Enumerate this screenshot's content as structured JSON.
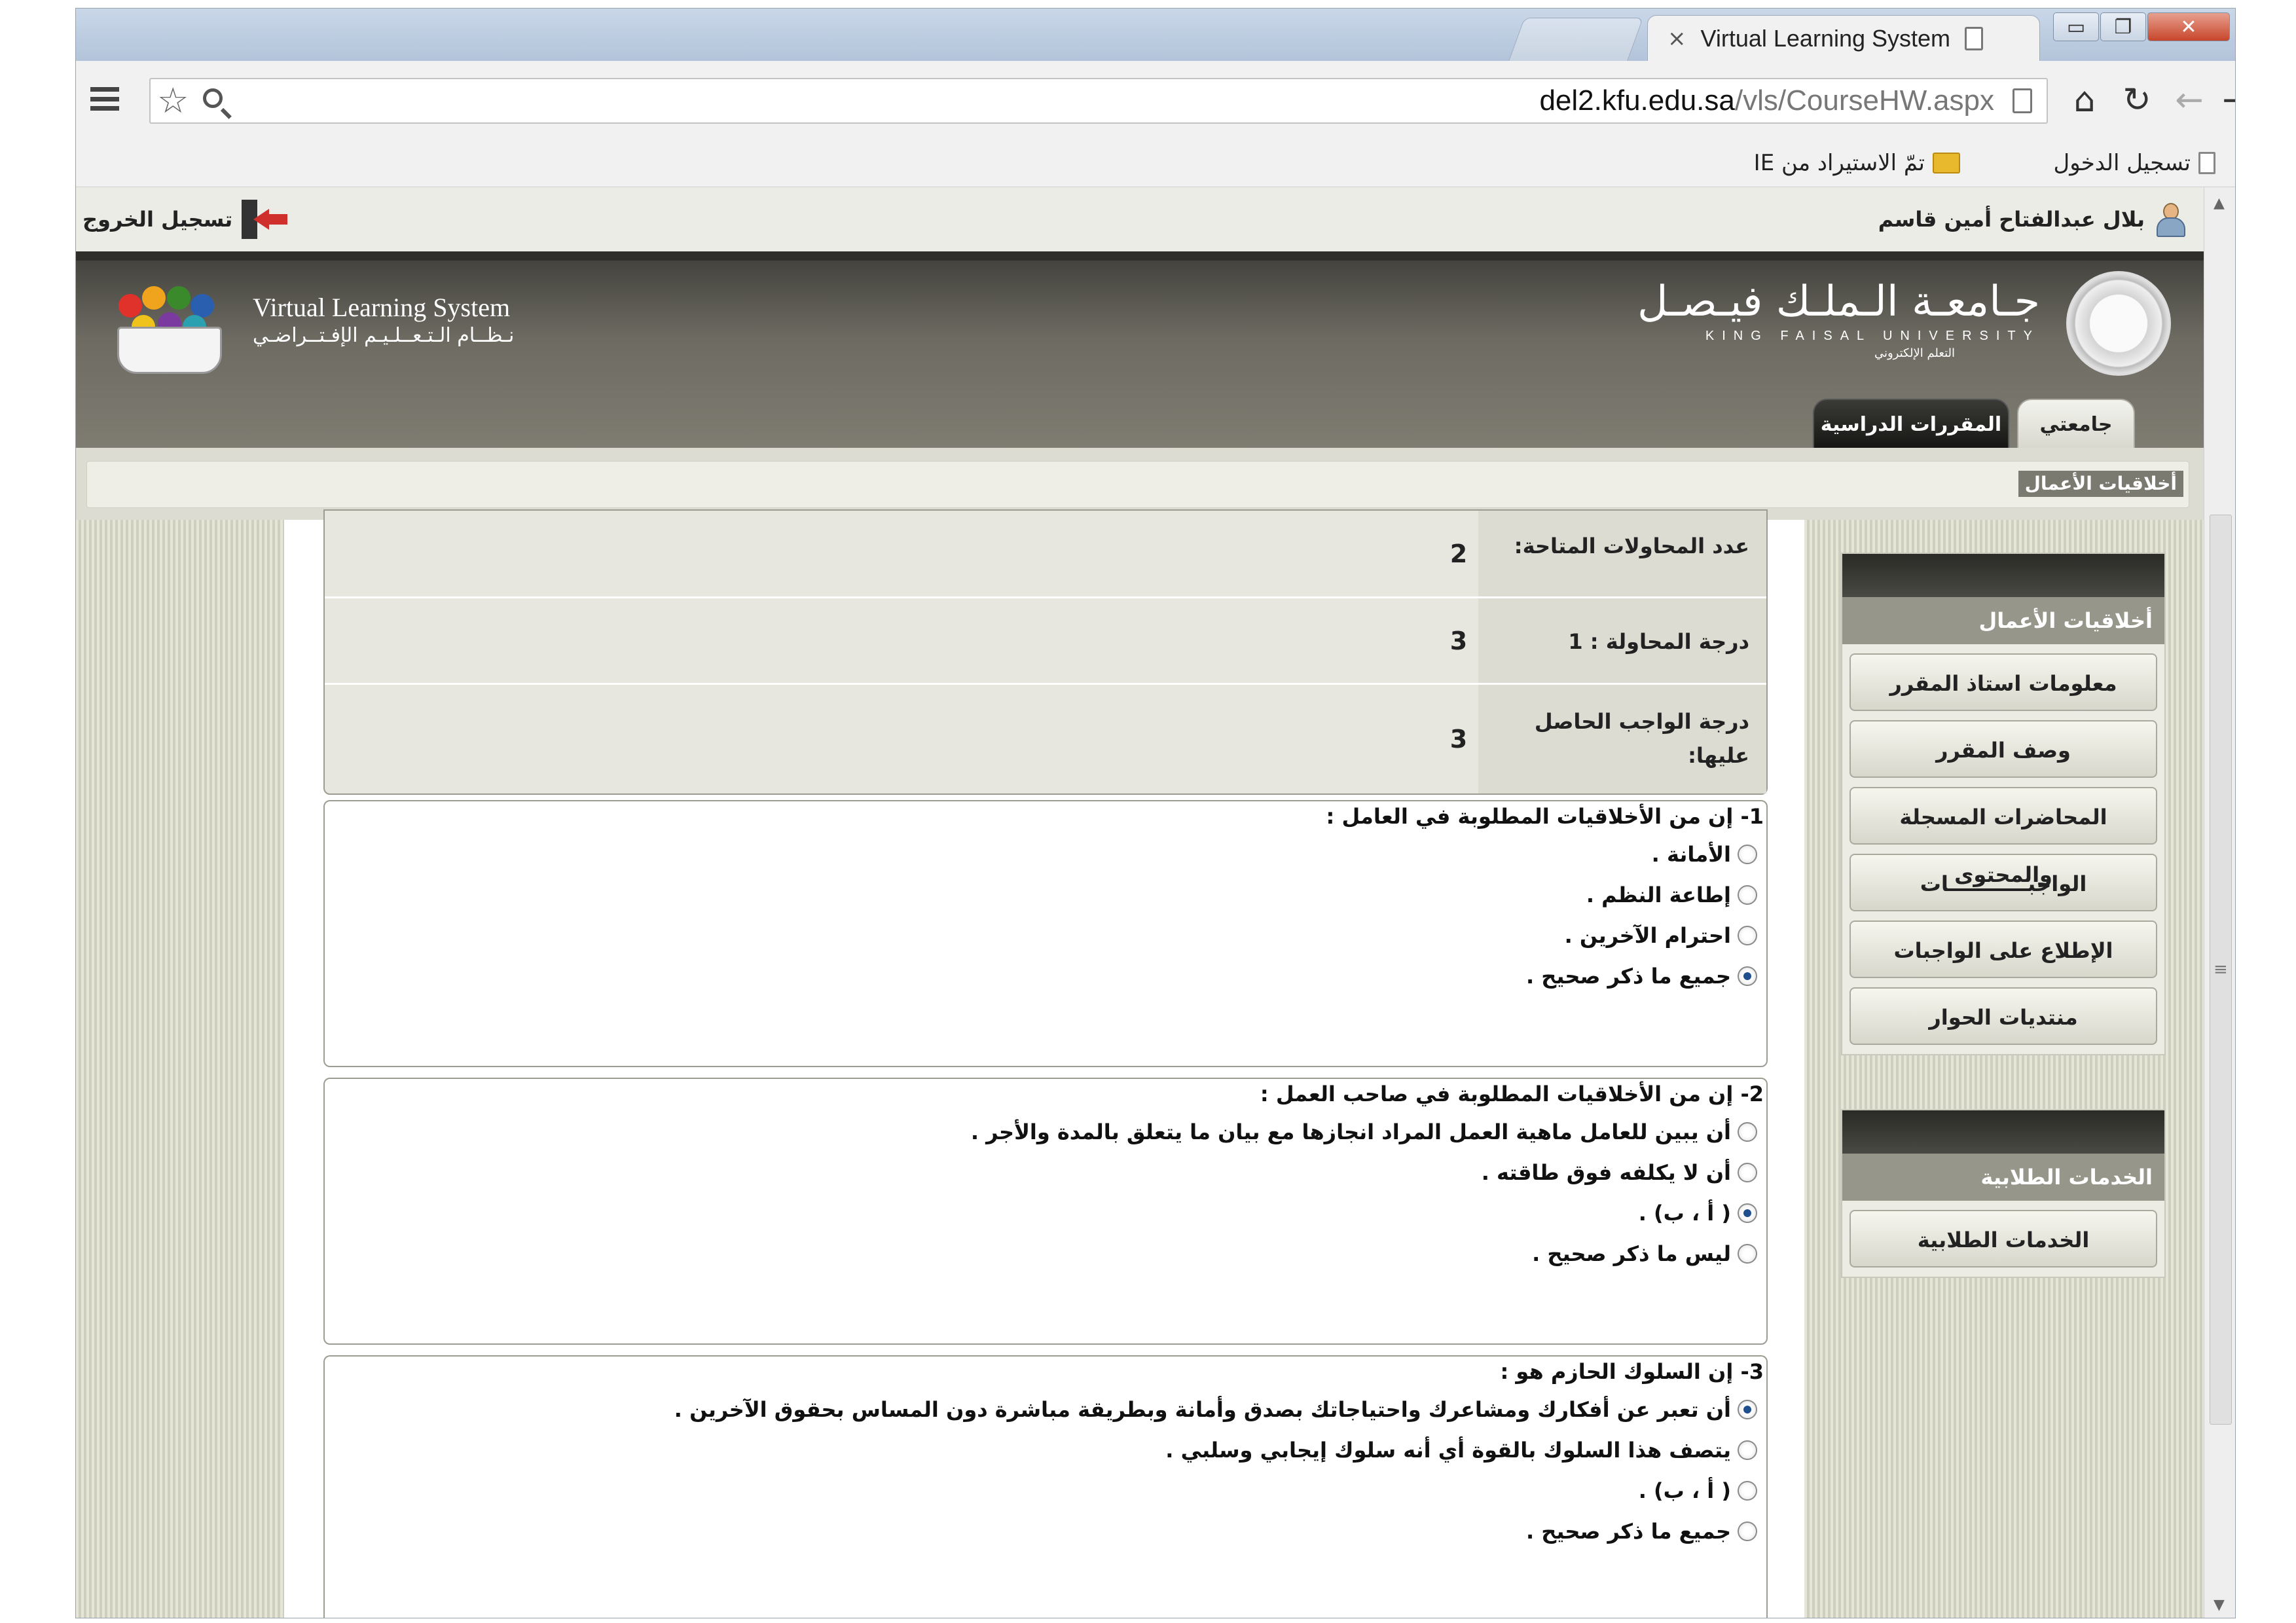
{
  "browser": {
    "tab_title": "Virtual Learning System",
    "tab_close": "×",
    "url_host": "del2.kfu.edu.sa",
    "url_path": "/vls/CourseHW.aspx",
    "window_controls": {
      "minimize": "▭",
      "maximize": "❐",
      "close": "✕"
    },
    "nav": {
      "home": "⌂",
      "reload": "↻",
      "back": "←",
      "forward": "→"
    },
    "bookmarks": [
      "تسجيل الدخول",
      "تمّ الاستيراد من IE"
    ]
  },
  "header": {
    "user_name": "بلال عبدالفتاح أمين قاسم",
    "logout_label": "تسجيل الخروج",
    "university_ar": "جـامعـة الـملـك فيـصـل",
    "university_en": "KING FAISAL UNIVERSITY",
    "university_sub": "التعلم الإلكتروني",
    "vls_en": "Virtual Learning System",
    "vls_ar": "نـظــام الـتـعــلـيـم الإفـتــراضـي",
    "tabs": [
      "جامعتي",
      "المقررات الدراسية"
    ],
    "breadcrumb": "أخلاقيات الأعمال"
  },
  "info": [
    {
      "label": "عدد المحاولات المتاحة:",
      "value": "2"
    },
    {
      "label": "درجة المحاولة : 1",
      "value": "3"
    },
    {
      "label": "درجة الواجب الحاصل عليها:",
      "value": "3"
    }
  ],
  "questions": [
    {
      "text": "1- إن من الأخلاقيات المطلوبة في العامل :",
      "options": [
        "الأمانة .",
        "إطاعة النظم .",
        "احترام الآخرين .",
        "جميع ما ذكر صحيح ."
      ],
      "selected": 3
    },
    {
      "text": "2- إن من الأخلاقيات المطلوبة في صاحب العمل :",
      "options": [
        "أن يبين للعامل ماهية العمل المراد انجازها مع بيان ما يتعلق بالمدة والأجر .",
        "أن لا يكلفه فوق طاقته .",
        "( أ ، ب) .",
        "ليس ما ذكر صحيح ."
      ],
      "selected": 2
    },
    {
      "text": "3- إن السلوك الحازم هو :",
      "options": [
        "أن تعبر عن أفكارك ومشاعرك واحتياجاتك بصدق وأمانة وبطريقة مباشرة دون المساس بحقوق الآخرين .",
        "يتصف هذا السلوك بالقوة أي أنه سلوك إيجابي وسلبي .",
        "( أ ، ب) .",
        "جميع ما ذكر صحيح ."
      ],
      "selected": 0
    }
  ],
  "sidebar": {
    "course_title": "أخلاقيات الأعمال",
    "course_items": [
      "معلومات استاذ المقرر",
      "وصف المقرر",
      "المحاضرات المسجلة والمحتوى",
      "الواجبـــــــــــات",
      "الإطلاع على الواجبات",
      "منتديات الحوار"
    ],
    "services_title": "الخدمات الطلابية",
    "services_items": [
      "الخدمات الطلابية"
    ]
  }
}
